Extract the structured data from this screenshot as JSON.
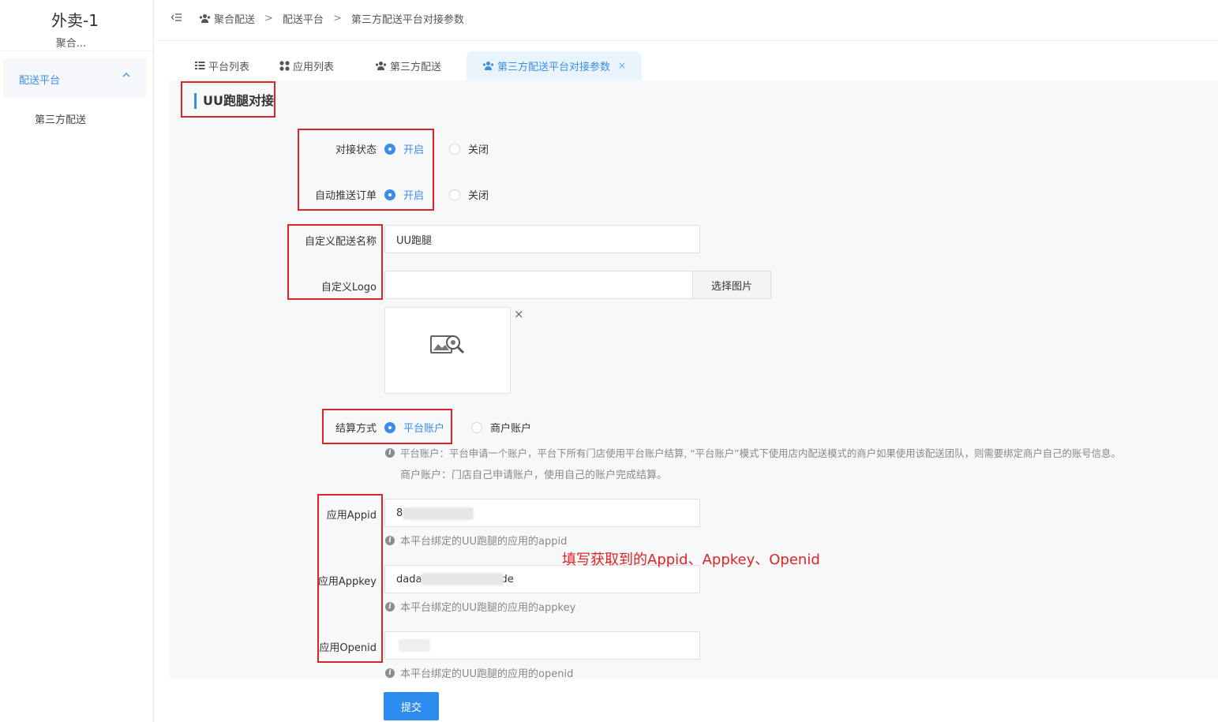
{
  "sidebar": {
    "app_title": "外卖-1",
    "app_subtitle": "聚合...",
    "menu_group": "配送平台",
    "menu_sub": "第三方配送"
  },
  "breadcrumb": [
    "聚合配送",
    "配送平台",
    "第三方配送平台对接参数"
  ],
  "breadcrumb_separator": ">",
  "tabs": [
    {
      "label": "平台列表",
      "icon": "list-icon"
    },
    {
      "label": "应用列表",
      "icon": "grid-icon"
    },
    {
      "label": "第三方配送",
      "icon": "users-icon"
    },
    {
      "label": "第三方配送平台对接参数",
      "icon": "users-icon",
      "active": true,
      "close": "×"
    }
  ],
  "section_title": "UU跑腿对接",
  "form": {
    "dock_status": {
      "label": "对接状态",
      "on": "开启",
      "off": "关闭",
      "selected": "开启"
    },
    "auto_push": {
      "label": "自动推送订单",
      "on": "开启",
      "off": "关闭",
      "selected": "开启"
    },
    "custom_name": {
      "label": "自定义配送名称",
      "value": "UU跑腿"
    },
    "custom_logo": {
      "label": "自定义Logo",
      "value": "",
      "button": "选择图片",
      "remove": "×"
    },
    "settlement": {
      "label": "结算方式",
      "option_platform": "平台账户",
      "option_merchant": "商户账户",
      "selected": "平台账户",
      "hint_line1": "平台账户：平台申请一个账户，平台下所有门店使用平台账户结算, “平台账户”模式下使用店内配送模式的商户如果使用该配送团队，则需要绑定商户自己的账号信息。",
      "hint_line2": "商户账户：门店自己申请账户，使用自己的账户完成结算。"
    },
    "appid": {
      "label": "应用Appid",
      "value_visible": "8",
      "hint": "本平台绑定的UU跑腿的应用的appid"
    },
    "appkey": {
      "label": "应用Appkey",
      "value_prefix": "dada",
      "value_suffix": "de",
      "hint": "本平台绑定的UU跑腿的应用的appkey"
    },
    "openid": {
      "label": "应用Openid",
      "value_visible": "",
      "hint": "本平台绑定的UU跑腿的应用的openid"
    },
    "submit": "提交"
  },
  "annotation": "填写获取到的Appid、Appkey、Openid",
  "colors": {
    "accent": "#3a8ee6",
    "submit": "#2d8cf0",
    "highlight": "#e02424"
  }
}
